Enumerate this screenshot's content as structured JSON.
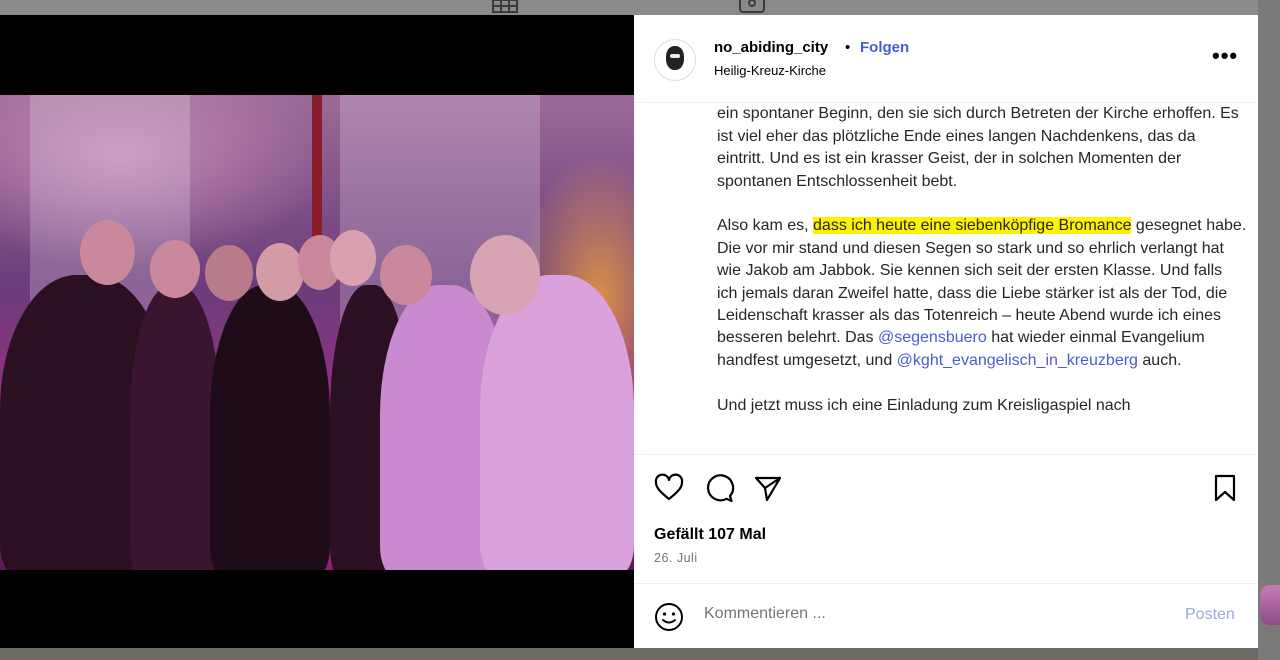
{
  "post": {
    "username": "no_abiding_city",
    "separator": "•",
    "follow_label": "Folgen",
    "location": "Heilig-Kreuz-Kirche",
    "more_label": "•••"
  },
  "caption": {
    "p1": "einer Kirche vorbeilaufen, wo spontane Trauungen stattfinden, ist es selten ein spontaner Beginn, den sie sich durch Betreten der Kirche erhoffen. Es ist viel eher das plötzliche Ende eines langen Nachdenkens, das da eintritt. Und es ist ein krasser Geist, der in solchen Momenten der spontanen Entschlossenheit bebt.",
    "p2_before": "Also kam es, ",
    "p2_highlight": "dass ich heute eine siebenköpfige Bromance",
    "p2_after": " gesegnet habe. Die vor mir stand und diesen Segen so stark und so ehrlich verlangt hat wie Jakob am Jabbok. Sie kennen sich seit der ersten Klasse. Und falls ich jemals daran Zweifel hatte, dass die Liebe stärker ist als der Tod, die Leidenschaft krasser als das Totenreich – heute Abend wurde ich eines besseren belehrt. Das ",
    "mention1": "@segensbuero",
    "p2_mid": " hat wieder einmal Evangelium handfest umgesetzt, und ",
    "mention2": "@kght_evangelisch_in_kreuzberg",
    "p2_end": " auch.",
    "p3": "Und jetzt muss ich eine Einladung zum Kreisligaspiel nach"
  },
  "stats": {
    "likes": "Gefällt 107 Mal",
    "date": "26. Juli"
  },
  "comment": {
    "placeholder": "Kommentieren ...",
    "post_label": "Posten"
  },
  "colors": {
    "accent": "#4a5bd8",
    "highlight": "#fff200",
    "post_disabled": "#9aa8e8"
  }
}
